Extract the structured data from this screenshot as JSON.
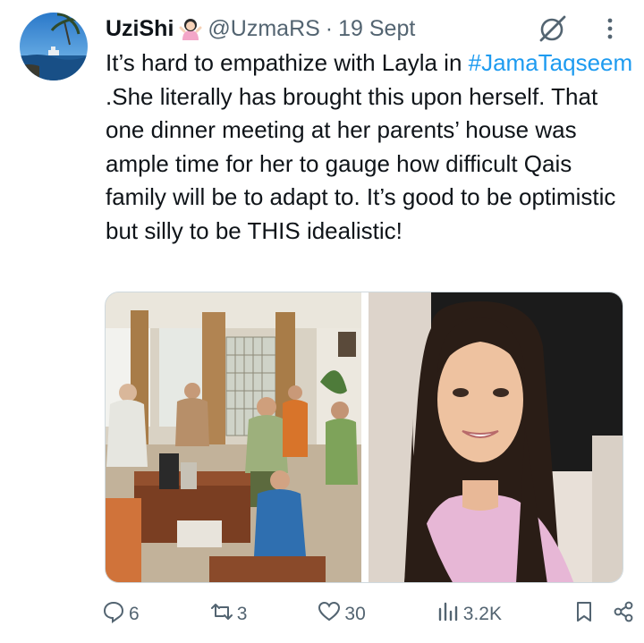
{
  "tweet": {
    "display_name": "UziShi",
    "handle": "@UzmaRS",
    "separator": "·",
    "date": "19 Sept",
    "text_before": "It’s hard to empathize with Layla in ",
    "hashtag": "#JamaTaqseem",
    "text_after": " .She literally has brought this upon herself. That one dinner meeting at her parents’ house was ample time for her to gauge how difficult Qais family will be to adapt to. It’s good to be optimistic but silly to be THIS idealistic!"
  },
  "actions": {
    "replies": "6",
    "reposts": "3",
    "likes": "30",
    "views": "3.2K"
  },
  "colors": {
    "link": "#1d9bf0",
    "secondary_text": "#536471",
    "primary_text": "#0f1419"
  },
  "icons": [
    "grok-icon",
    "more-icon",
    "reply-icon",
    "repost-icon",
    "like-icon",
    "views-icon",
    "bookmark-icon",
    "share-icon"
  ]
}
